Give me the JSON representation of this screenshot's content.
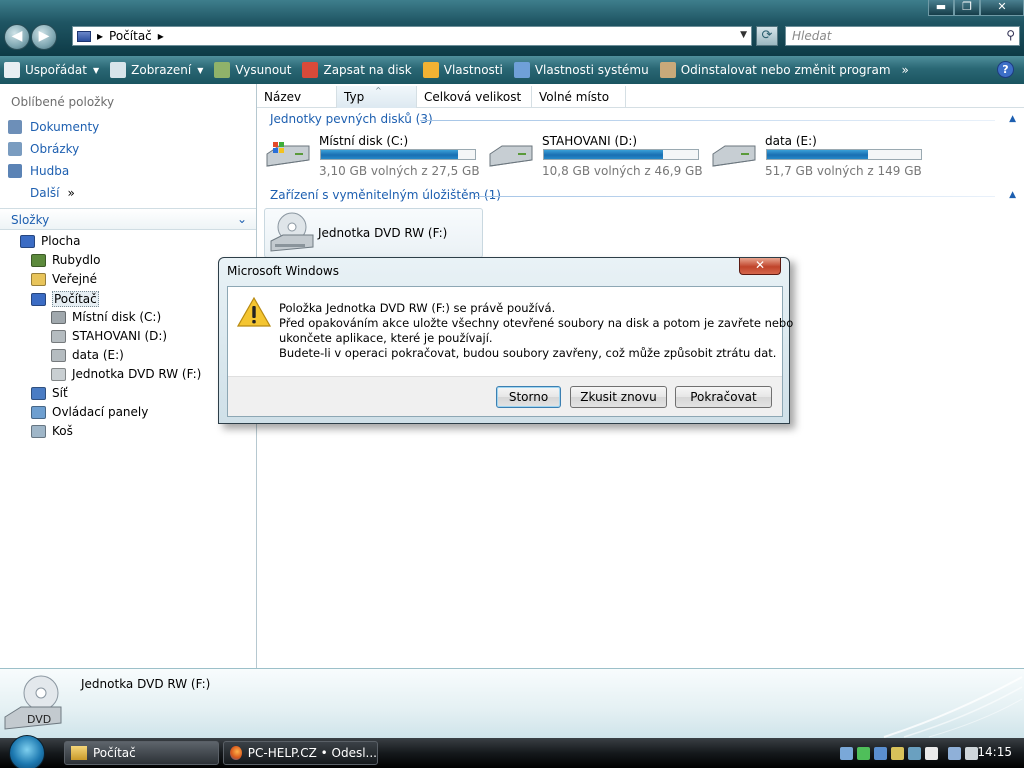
{
  "window": {
    "controls": {
      "minimize": "▬",
      "maximize": "❐",
      "close": "✕"
    }
  },
  "nav": {
    "back": "◀",
    "forward": "▶"
  },
  "address": {
    "crumb": "Počítač",
    "sep": "▸",
    "sep2": "▸",
    "dropdown": "▼",
    "refresh": "⟳"
  },
  "search": {
    "placeholder": "Hledat",
    "icon": "search-icon"
  },
  "toolbar": {
    "items": [
      {
        "label": "Uspořádat",
        "icon": "organize-icon",
        "color": "#e8eef2",
        "caret": true
      },
      {
        "label": "Zobrazení",
        "icon": "views-icon",
        "color": "#d8e4ea",
        "caret": true
      },
      {
        "label": "Vysunout",
        "icon": "eject-icon",
        "color": "#8fb26a"
      },
      {
        "label": "Zapsat na disk",
        "icon": "burn-disc-icon",
        "color": "#d94a3a"
      },
      {
        "label": "Vlastnosti",
        "icon": "properties-icon",
        "color": "#f2b233"
      },
      {
        "label": "Vlastnosti systému",
        "icon": "system-properties-icon",
        "color": "#6fa0d8"
      },
      {
        "label": "Odinstalovat nebo změnit program",
        "icon": "uninstall-icon",
        "color": "#c9a97a"
      }
    ],
    "more": "»",
    "help": "?"
  },
  "left": {
    "favorites_title": "Oblíbené položky",
    "favorites": [
      {
        "label": "Dokumenty",
        "icon": "documents-icon",
        "color": "#6d8fb8"
      },
      {
        "label": "Obrázky",
        "icon": "pictures-icon",
        "color": "#7a9cc0"
      },
      {
        "label": "Hudba",
        "icon": "music-icon",
        "color": "#5b83b5"
      },
      {
        "label": "Další",
        "icon": "",
        "color": ""
      }
    ],
    "favorites_more": "»",
    "folders_label": "Složky",
    "folders_chev": "⌄",
    "tree": [
      {
        "label": "Plocha",
        "icon": "desktop-icon",
        "color": "#3b6cc4",
        "indent": 0
      },
      {
        "label": "Rubydlo",
        "icon": "user-folder-icon",
        "color": "#5c8a3c",
        "indent": 1
      },
      {
        "label": "Veřejné",
        "icon": "public-folder-icon",
        "color": "#e8c45a",
        "indent": 1
      },
      {
        "label": "Počítač",
        "icon": "computer-icon",
        "color": "#3b6cc4",
        "indent": 1,
        "selected": true
      },
      {
        "label": "Místní disk (C:)",
        "icon": "system-drive-icon",
        "color": "#a0a8ad",
        "indent": 2
      },
      {
        "label": "STAHOVANI (D:)",
        "icon": "hard-drive-icon",
        "color": "#b5bcc0",
        "indent": 2
      },
      {
        "label": "data (E:)",
        "icon": "hard-drive-icon",
        "color": "#b5bcc0",
        "indent": 2
      },
      {
        "label": "Jednotka DVD RW (F:)",
        "icon": "dvd-drive-icon",
        "color": "#c9cfd2",
        "indent": 2
      },
      {
        "label": "Síť",
        "icon": "network-icon",
        "color": "#4a7cc4",
        "indent": 1
      },
      {
        "label": "Ovládací panely",
        "icon": "control-panel-icon",
        "color": "#6e9fd0",
        "indent": 1
      },
      {
        "label": "Koš",
        "icon": "recycle-bin-icon",
        "color": "#9fb6c8",
        "indent": 1
      }
    ]
  },
  "main": {
    "columns": [
      "Název",
      "Typ",
      "Celková velikost",
      "Volné místo"
    ],
    "sort_mark": "^",
    "groups": [
      {
        "label": "Jednotky pevných disků (3)",
        "chev": "▲"
      },
      {
        "label": "Zařízení s vyměnitelným úložištěm (1)",
        "chev": "▲"
      }
    ],
    "drives": [
      {
        "name": "Místní disk (C:)",
        "free": "3,10 GB volných z 27,5 GB",
        "used_fraction": 0.887,
        "icon": "system-drive-icon"
      },
      {
        "name": "STAHOVANI (D:)",
        "free": "10,8 GB volných z 46,9 GB",
        "used_fraction": 0.77,
        "icon": "hard-drive-icon"
      },
      {
        "name": "data (E:)",
        "free": "51,7 GB volných z 149 GB",
        "used_fraction": 0.653,
        "icon": "hard-drive-icon"
      }
    ],
    "dvd": {
      "name": "Jednotka DVD RW (F:)",
      "icon": "dvd-drive-icon"
    }
  },
  "details": {
    "name": "Jednotka DVD RW (F:)",
    "icon_label": "DVD"
  },
  "taskbar": {
    "tasks": [
      {
        "label": "Počítač",
        "icon": "folder-icon"
      },
      {
        "label": "PC-HELP.CZ • Odesl...",
        "icon": "firefox-icon"
      }
    ],
    "clock": "14:15"
  },
  "dialog": {
    "title": "Microsoft Windows",
    "close": "✕",
    "lines": [
      "Položka Jednotka DVD RW (F:) se právě používá.",
      "Před opakováním akce uložte všechny otevřené soubory na disk a potom je zavřete nebo",
      "ukončete aplikace, které je používají.",
      "Budete-li v operaci pokračovat, budou soubory zavřeny, což může způsobit ztrátu dat."
    ],
    "buttons": {
      "cancel": "Storno",
      "retry": "Zkusit znovu",
      "continue": "Pokračovat"
    }
  }
}
